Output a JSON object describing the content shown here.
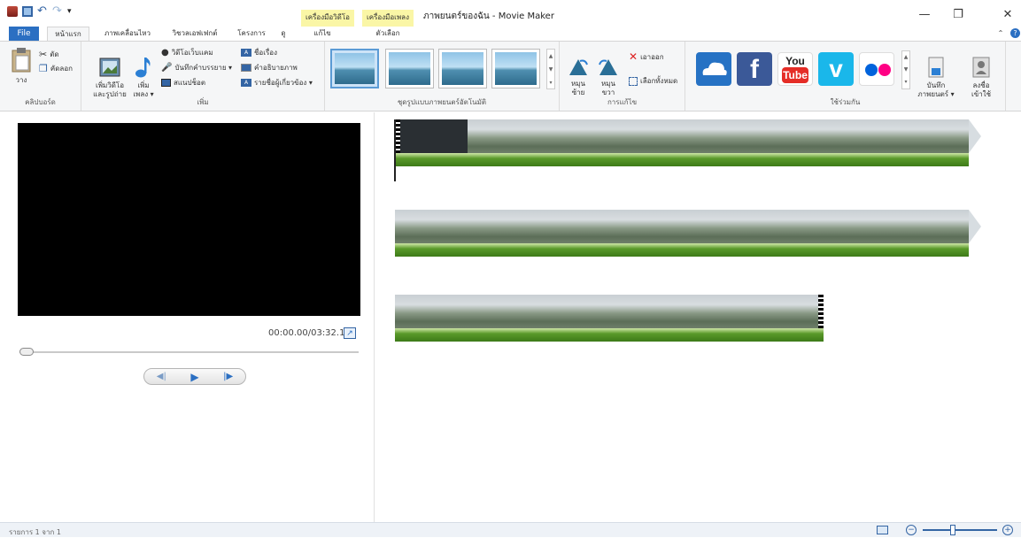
{
  "titlebar": {
    "app_title": "ภาพยนตร์ของฉัน - Movie Maker",
    "context_tab_video": "เครื่องมือวิดีโอ",
    "context_tab_music": "เครื่องมือเพลง",
    "minimize": "—",
    "restore": "❐",
    "close": "✕"
  },
  "tabs": {
    "file": "File",
    "home": "หน้าแรก",
    "animations": "ภาพเคลื่อนไหว",
    "visual_effects": "วิชวลเอฟเฟกต์",
    "project": "โครงการ",
    "view": "ดู",
    "edit": "แก้ไข",
    "options": "ตัวเลือก"
  },
  "ribbon": {
    "clipboard": {
      "label": "คลิปบอร์ด",
      "paste": "วาง",
      "cut": "ตัด",
      "copy": "คัดลอก"
    },
    "add": {
      "label": "เพิ่ม",
      "add_videos_photos": "เพิ่มวิดีโอ\nและรูปถ่าย",
      "add_music": "เพิ่ม\nเพลง ▾",
      "webcam": "วิดีโอเว็บแคม",
      "narration": "บันทึกคำบรรยาย ▾",
      "snapshot": "สแนปช็อต",
      "title": "ชื่อเรื่อง",
      "caption": "คำอธิบายภาพ",
      "credits": "รายชื่อผู้เกี่ยวข้อง ▾"
    },
    "themes": {
      "label": "ชุดรูปแบบภาพยนตร์อัตโนมัติ"
    },
    "editing": {
      "label": "การแก้ไข",
      "rotate_left": "หมุน\nซ้าย",
      "rotate_right": "หมุน\nขวา",
      "remove": "เอาออก",
      "select_all": "เลือกทั้งหมด"
    },
    "share": {
      "label": "ใช้ร่วมกัน",
      "save_movie": "บันทึก\nภาพยนตร์ ▾",
      "sign_in": "ลงชื่อ\nเข้าใช้",
      "youtube_top": "You",
      "youtube_bottom": "Tube",
      "facebook": "f",
      "vimeo": "v"
    }
  },
  "preview": {
    "timecode": "00:00.00/03:32.18"
  },
  "status": {
    "text": "รายการ 1 จาก 1"
  },
  "colors": {
    "file_tab": "#2b6fc2",
    "context_tab": "#faf6a6",
    "onedrive": "#2672c4",
    "facebook": "#3b5998",
    "youtube": "#e52d27",
    "vimeo": "#1ab7ea",
    "flickr_pink": "#ff0084",
    "flickr_blue": "#0063dc"
  }
}
